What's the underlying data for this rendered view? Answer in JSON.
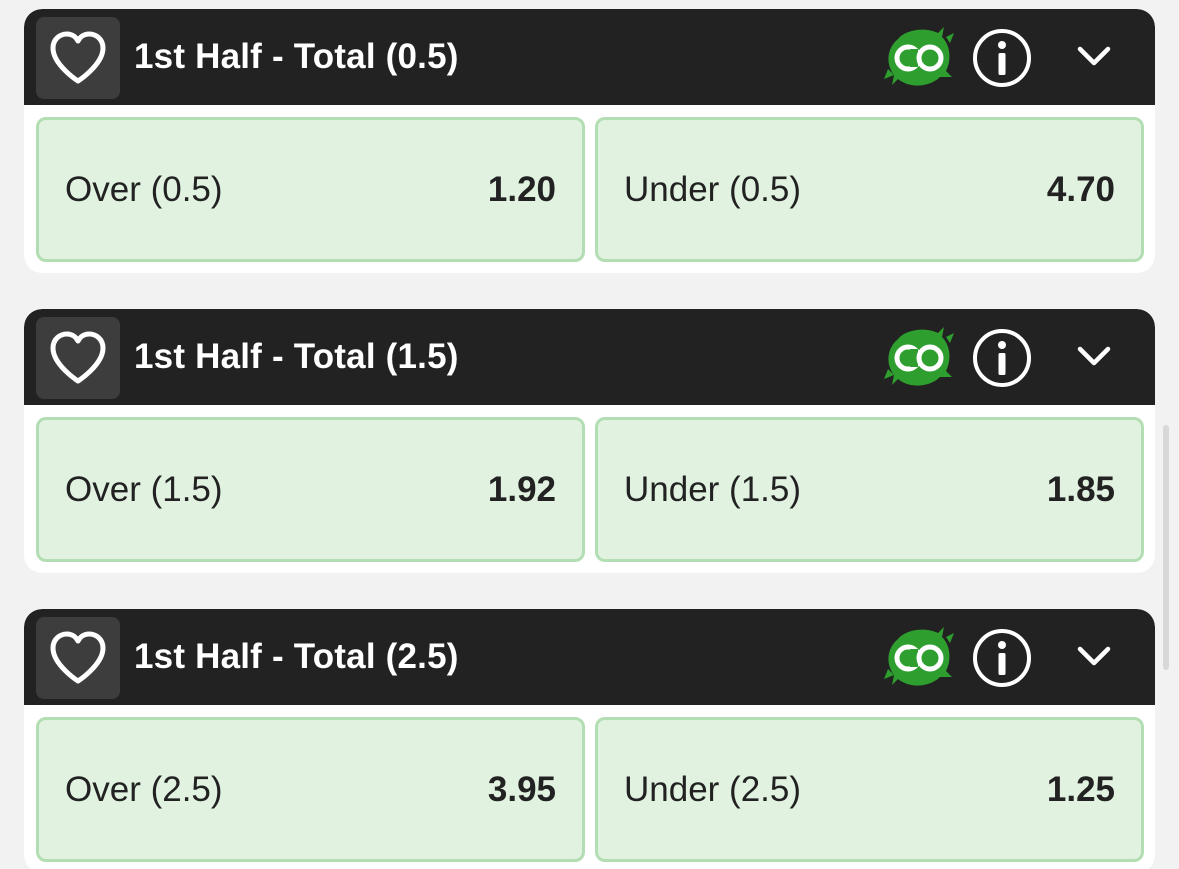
{
  "colors": {
    "header_bg": "#222222",
    "outcome_bg": "#e1f2e1",
    "outcome_border": "#b3deb3",
    "accent_green": "#2e9e2e"
  },
  "markets": [
    {
      "title": "1st Half - Total (0.5)",
      "icons": [
        "heart-icon",
        "cash-out-icon",
        "info-icon",
        "chevron-down-icon"
      ],
      "outcomes": [
        {
          "label": "Over (0.5)",
          "odds": "1.20"
        },
        {
          "label": "Under (0.5)",
          "odds": "4.70"
        }
      ]
    },
    {
      "title": "1st Half - Total (1.5)",
      "icons": [
        "heart-icon",
        "cash-out-icon",
        "info-icon",
        "chevron-down-icon"
      ],
      "outcomes": [
        {
          "label": "Over (1.5)",
          "odds": "1.92"
        },
        {
          "label": "Under (1.5)",
          "odds": "1.85"
        }
      ]
    },
    {
      "title": "1st Half - Total (2.5)",
      "icons": [
        "heart-icon",
        "cash-out-icon",
        "info-icon",
        "chevron-down-icon"
      ],
      "outcomes": [
        {
          "label": "Over (2.5)",
          "odds": "3.95"
        },
        {
          "label": "Under (2.5)",
          "odds": "1.25"
        }
      ]
    }
  ]
}
